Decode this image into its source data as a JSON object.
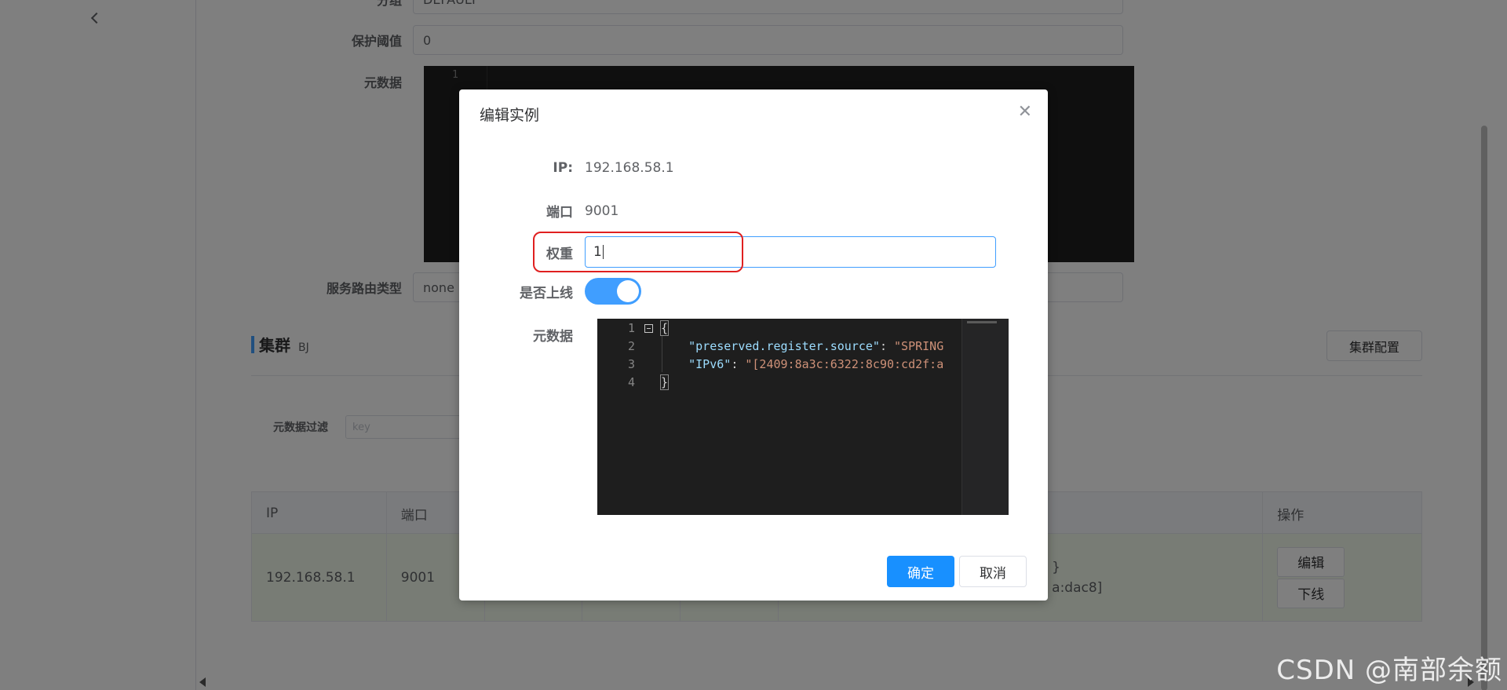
{
  "background": {
    "form": {
      "group_label": "分组",
      "group_value": "DEFAULT",
      "threshold_label": "保护阈值",
      "threshold_value": "0",
      "metadata_label": "元数据",
      "metadata_line": "1",
      "route_label": "服务路由类型",
      "route_value": "none"
    },
    "cluster": {
      "title": "集群",
      "subtitle": "BJ",
      "config_button": "集群配置",
      "filter_label": "元数据过滤",
      "filter_placeholder": "key"
    },
    "table": {
      "headers": [
        "IP",
        "端口",
        "",
        "",
        "",
        "",
        "操作"
      ],
      "row": {
        "ip": "192.168.58.1",
        "port": "9001",
        "metadata_line1": "}",
        "metadata_line2": "a:dac8]",
        "edit": "编辑",
        "offline": "下线"
      }
    }
  },
  "dialog": {
    "title": "编辑实例",
    "ip_label": "IP:",
    "ip_value": "192.168.58.1",
    "port_label": "端口",
    "port_value": "9001",
    "weight_label": "权重",
    "weight_value": "1",
    "online_label": "是否上线",
    "online_on": true,
    "metadata_label": "元数据",
    "code_lines": [
      "1",
      "2",
      "3",
      "4"
    ],
    "code": {
      "open": "{",
      "k1": "\"preserved.register.source\"",
      "v1": "\"SPRING",
      "k2": "\"IPv6\"",
      "v2": "\"[2409:8a3c:6322:8c90:cd2f:a",
      "close": "}"
    },
    "confirm": "确定",
    "cancel": "取消"
  },
  "watermark": "CSDN @南部余额",
  "colors": {
    "primary": "#1890ff",
    "switch_on": "#409eff",
    "highlight": "#e02020",
    "row_bg": "#f0f9eb",
    "overlay": "rgba(0,0,0,0.5)"
  }
}
